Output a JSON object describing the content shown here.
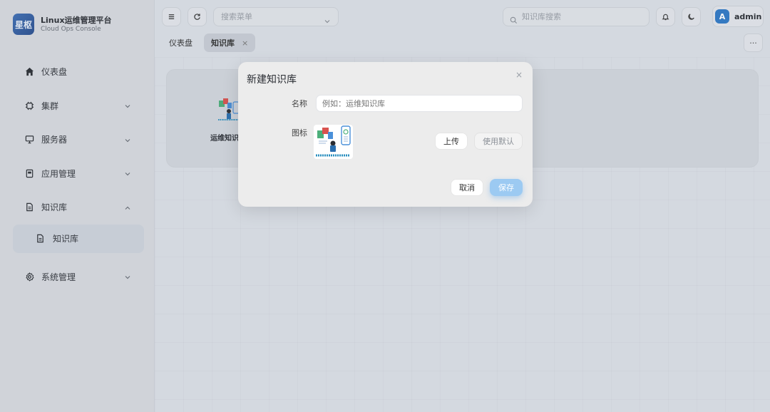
{
  "brand": {
    "logo_text": "星枢",
    "title": "Linux运维管理平台",
    "subtitle": "Cloud Ops Console"
  },
  "sidebar": {
    "items": [
      {
        "label": "仪表盘",
        "icon": "home-icon",
        "expandable": false
      },
      {
        "label": "集群",
        "icon": "cluster-icon",
        "expandable": true
      },
      {
        "label": "服务器",
        "icon": "monitor-icon",
        "expandable": true
      },
      {
        "label": "应用管理",
        "icon": "app-icon",
        "expandable": true
      },
      {
        "label": "知识库",
        "icon": "document-icon",
        "expandable": true,
        "expanded": true
      },
      {
        "label": "系统管理",
        "icon": "gear-icon",
        "expandable": true
      }
    ],
    "sub_item": {
      "label": "知识库",
      "icon": "document-icon",
      "active": true
    }
  },
  "topbar": {
    "menu_search_placeholder": "搜索菜单",
    "kb_search_placeholder": "知识库搜索",
    "user": {
      "avatar_letter": "A",
      "name": "admin"
    }
  },
  "tabs": [
    {
      "label": "仪表盘",
      "active": false
    },
    {
      "label": "知识库",
      "active": true,
      "close": "×"
    }
  ],
  "more_label": "···",
  "content": {
    "kb_card_label": "运维知识库"
  },
  "modal": {
    "title": "新建知识库",
    "close": "×",
    "name_label": "名称",
    "name_placeholder": "例如：运维知识库",
    "icon_label": "图标",
    "upload_label": "上传",
    "default_label": "使用默认",
    "cancel_label": "取消",
    "save_label": "保存"
  },
  "colors": {
    "accent": "#2f79c6",
    "save_button": "#9ccaf2",
    "logo": "#3f6fb5"
  }
}
